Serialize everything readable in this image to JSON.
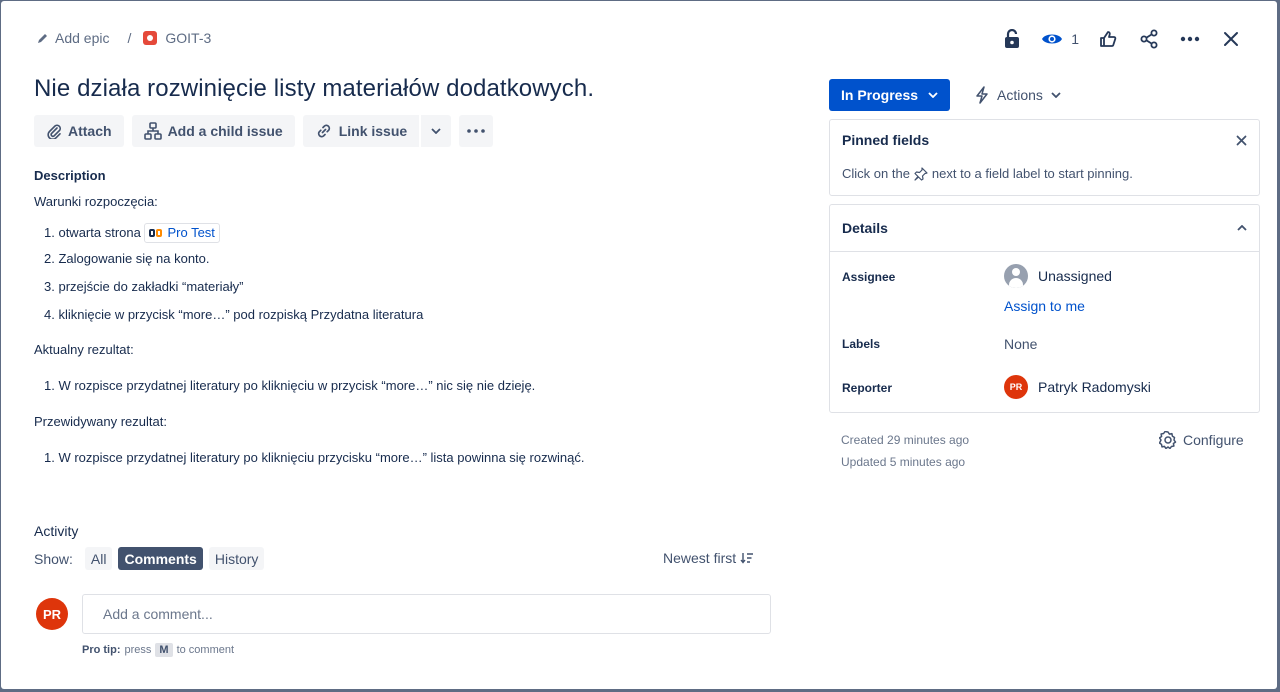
{
  "breadcrumbs": {
    "epic": "Add epic",
    "separator": "/",
    "issue_key": "GOIT-3"
  },
  "header": {
    "watch_count": "1"
  },
  "issue": {
    "title": "Nie działa rozwinięcie listy materiałów dodatkowych."
  },
  "toolbar": {
    "attach": "Attach",
    "add_child": "Add a child issue",
    "link_issue": "Link issue"
  },
  "description": {
    "label": "Description",
    "start_heading": "Warunki rozpoczęcia:",
    "steps": [
      {
        "num": "1.",
        "before": "otwarta strona",
        "link": "Pro Test"
      },
      {
        "num": "2.",
        "text": "Zalogowanie się na konto."
      },
      {
        "num": "3.",
        "text": "przejście do zakładki “materiały”"
      },
      {
        "num": "4.",
        "text": "kliknięcie w przycisk “more…” pod rozpiską Przydatna literatura"
      }
    ],
    "actual_heading": "Aktualny rezultat:",
    "actual": [
      {
        "num": "1.",
        "text": "W rozpisce przydatnej literatury po kliknięciu w przycisk “more…” nic się nie dzieję."
      }
    ],
    "expected_heading": "Przewidywany rezultat:",
    "expected": [
      {
        "num": "1.",
        "text": "W rozpisce przydatnej literatury po kliknięciu przycisku “more…” lista powinna się rozwinąć."
      }
    ]
  },
  "activity": {
    "label": "Activity",
    "show_label": "Show:",
    "filters": [
      "All",
      "Comments",
      "History"
    ],
    "active_filter": "Comments",
    "sort": "Newest first",
    "user_initials": "PR",
    "comment_placeholder": "Add a comment...",
    "protip_bold": "Pro tip:",
    "protip_press": "press",
    "protip_key": "M",
    "protip_rest": "to comment"
  },
  "sidebar": {
    "status": "In Progress",
    "actions": "Actions",
    "pinned": {
      "title": "Pinned fields",
      "text_before": "Click on the",
      "text_after": "next to a field label to start pinning."
    },
    "details": {
      "title": "Details",
      "assignee_label": "Assignee",
      "assignee_value": "Unassigned",
      "assign_to_me": "Assign to me",
      "labels_label": "Labels",
      "labels_value": "None",
      "reporter_label": "Reporter",
      "reporter_initials": "PR",
      "reporter_value": "Patryk Radomyski"
    },
    "created": "Created 29 minutes ago",
    "updated": "Updated 5 minutes ago",
    "configure": "Configure"
  },
  "colors": {
    "primary": "#0052cc",
    "text": "#172b4d",
    "subtle": "#42526e",
    "avatar": "#de350b",
    "bug": "#e5493a"
  }
}
